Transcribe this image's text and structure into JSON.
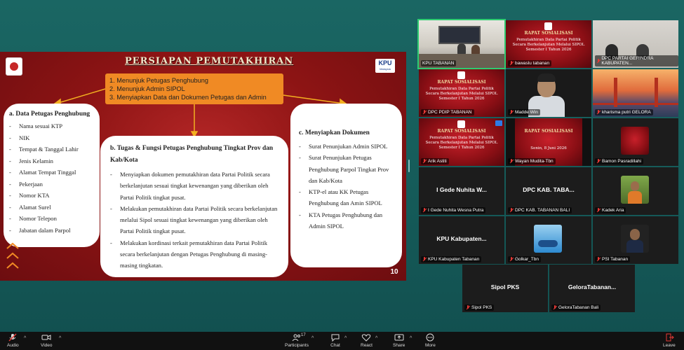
{
  "slide": {
    "title": "PERSIAPAN PEMUTAKHIRAN",
    "logo_right": {
      "name": "KPU",
      "sub": "Malaysia"
    },
    "steps": [
      "1. Menunjuk Petugas Penghubung",
      "2. Menunjuk Admin SIPOL",
      "3. Menyiapkan Data dan Dokumen Petugas dan Admin"
    ],
    "card_a": {
      "heading": "a.  Data Petugas Penghubung",
      "items": [
        "Nama sesuai KTP",
        "NIK",
        "Tempat & Tanggal Lahir",
        "Jenis Kelamin",
        "Alamat Tempat Tinggal",
        "Pekerjaan",
        "Nomor KTA",
        "Alamat Surel",
        "Nomor Telepon",
        "Jabatan dalam Parpol"
      ]
    },
    "card_b": {
      "heading": "b.  Tugas & Fungsi Petugas Penghubung Tingkat Prov dan Kab/Kota",
      "items": [
        "Menyiapkan dokumen pemutakhiran data Partai Politik secara berkelanjutan sesuai tingkat kewenangan yang diberikan oleh Partai Politik tingkat pusat.",
        "Melakukan pemutakhiran data Partai Politik secara berkelanjutan melalui Sipol sesuai tingkat kewenangan yang diberikan oleh Partai Politik tingkat pusat.",
        "Melakukan kordinasi terkait pemutakhiran data Partai Politik secara berkelanjutan dengan Petugas Penghubung di masing-masing tingkatan."
      ]
    },
    "card_c": {
      "heading": "c.  Menyiapkan Dokumen",
      "items": [
        "Surat Penunjukan Admin SIPOL",
        "Surat Penunjukan Petugas Penghubung Parpol Tingkat Prov dan Kab/Kota",
        "KTP-el atau KK Petugas Penghubung dan Amin SIPOL",
        "KTA Petugas Penghubung dan Admin SIPOL"
      ]
    },
    "page_number": "10"
  },
  "sosialisasi": {
    "title": "RAPAT SOSIALISASI",
    "subtitle": "Pemutakhiran Data Partai Politik Secara Berkelanjutan Melalui SIPOL Semester I Tahun 2026",
    "date": "Senin, 8 Juni 2026"
  },
  "participants": [
    {
      "name": "KPU TABANAN",
      "muted": false,
      "display": ""
    },
    {
      "name": "bawaslu tabanan",
      "muted": true,
      "display": ""
    },
    {
      "name": "DPC PARTAI GERINDRA KABUPATEN...",
      "muted": true,
      "display": ""
    },
    {
      "name": "DPC PDIP TABANAN",
      "muted": true,
      "display": ""
    },
    {
      "name": "Madde Win",
      "muted": true,
      "display": ""
    },
    {
      "name": "kharisma putri GELORA",
      "muted": true,
      "display": ""
    },
    {
      "name": "Arik Astiti",
      "muted": true,
      "display": ""
    },
    {
      "name": "Wayan Mudita-Tbn",
      "muted": true,
      "display": ""
    },
    {
      "name": "Bamon Pasradillahi",
      "muted": true,
      "display": ""
    },
    {
      "name": "I Gede Nuhita Wesna Putra",
      "muted": true,
      "display": "I Gede Nuhita W..."
    },
    {
      "name": "DPC KAB. TABANAN BALI",
      "muted": true,
      "display": "DPC KAB. TABA..."
    },
    {
      "name": "Kadek Aria",
      "muted": true,
      "display": ""
    },
    {
      "name": "KPU Kabupaten Tabanan",
      "muted": true,
      "display": "KPU Kabupaten..."
    },
    {
      "name": "Golkar_Tbn",
      "muted": true,
      "display": ""
    },
    {
      "name": "PSI Tabanan",
      "muted": true,
      "display": ""
    },
    {
      "name": "Sipol PKS",
      "muted": true,
      "display": "Sipol PKS"
    },
    {
      "name": "GeloraTabanan Bali",
      "muted": true,
      "display": "GeloraTabanan..."
    }
  ],
  "toolbar": {
    "audio": "Audio",
    "video": "Video",
    "participants": "Participants",
    "participants_count": "17",
    "chat": "Chat",
    "react": "React",
    "share": "Share",
    "more": "More",
    "leave": "Leave"
  },
  "colors": {
    "accent_orange": "#f08a24",
    "slide_red": "#8d1414",
    "leave_red": "#e53935",
    "active_green": "#2ecc71"
  }
}
